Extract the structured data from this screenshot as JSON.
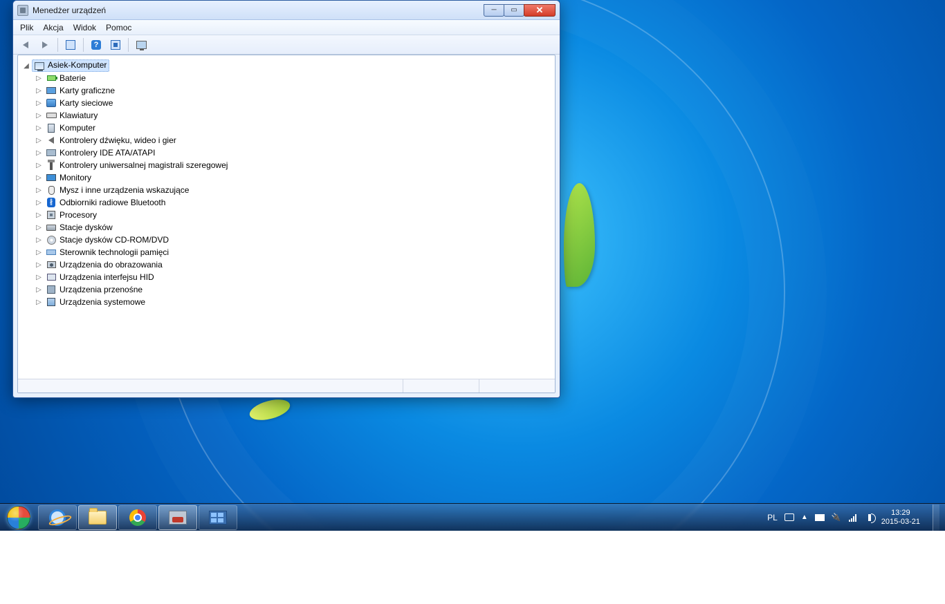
{
  "window": {
    "title": "Menedżer urządzeń",
    "menus": [
      "Plik",
      "Akcja",
      "Widok",
      "Pomoc"
    ],
    "tree": {
      "root": "Asiek-Komputer",
      "items": [
        {
          "label": "Baterie",
          "icon": "battery"
        },
        {
          "label": "Karty graficzne",
          "icon": "display"
        },
        {
          "label": "Karty sieciowe",
          "icon": "net"
        },
        {
          "label": "Klawiatury",
          "icon": "kbd"
        },
        {
          "label": "Komputer",
          "icon": "pc"
        },
        {
          "label": "Kontrolery dźwięku, wideo i gier",
          "icon": "sound"
        },
        {
          "label": "Kontrolery IDE ATA/ATAPI",
          "icon": "ide"
        },
        {
          "label": "Kontrolery uniwersalnej magistrali szeregowej",
          "icon": "usb"
        },
        {
          "label": "Monitory",
          "icon": "monitor"
        },
        {
          "label": "Mysz i inne urządzenia wskazujące",
          "icon": "mouse"
        },
        {
          "label": "Odbiorniki radiowe Bluetooth",
          "icon": "bt"
        },
        {
          "label": "Procesory",
          "icon": "cpu"
        },
        {
          "label": "Stacje dysków",
          "icon": "disk"
        },
        {
          "label": "Stacje dysków CD-ROM/DVD",
          "icon": "cd"
        },
        {
          "label": "Sterownik technologii pamięci",
          "icon": "mem"
        },
        {
          "label": "Urządzenia do obrazowania",
          "icon": "cam"
        },
        {
          "label": "Urządzenia interfejsu HID",
          "icon": "hid"
        },
        {
          "label": "Urządzenia przenośne",
          "icon": "port"
        },
        {
          "label": "Urządzenia systemowe",
          "icon": "sys"
        }
      ]
    }
  },
  "taskbar": {
    "lang": "PL",
    "time": "13:29",
    "date": "2015-03-21"
  }
}
